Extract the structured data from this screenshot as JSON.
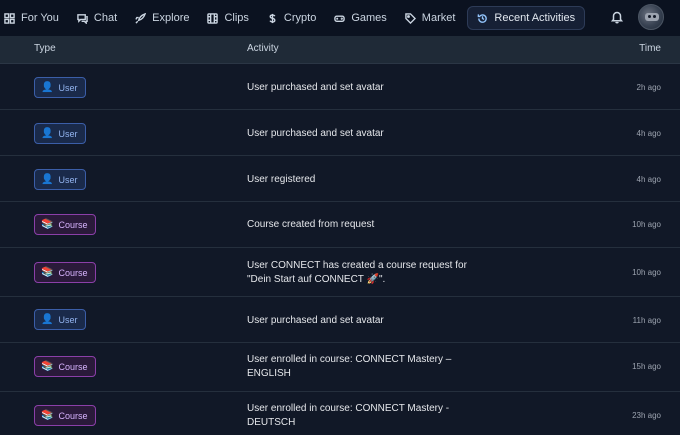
{
  "nav": {
    "items": [
      {
        "label": "For You",
        "icon": "grid-icon"
      },
      {
        "label": "Chat",
        "icon": "chat-icon"
      },
      {
        "label": "Explore",
        "icon": "rocket-icon"
      },
      {
        "label": "Clips",
        "icon": "film-icon"
      },
      {
        "label": "Crypto",
        "icon": "dollar-icon"
      },
      {
        "label": "Games",
        "icon": "gamepad-icon"
      },
      {
        "label": "Market",
        "icon": "tag-icon"
      },
      {
        "label": "Recent Activities",
        "icon": "history-icon",
        "active": true
      }
    ]
  },
  "table": {
    "headers": {
      "type": "Type",
      "activity": "Activity",
      "time": "Time"
    },
    "rows": [
      {
        "type": "User",
        "activity": "User purchased and set avatar",
        "time": "2h ago"
      },
      {
        "type": "User",
        "activity": "User purchased and set avatar",
        "time": "4h ago"
      },
      {
        "type": "User",
        "activity": "User registered",
        "time": "4h ago"
      },
      {
        "type": "Course",
        "activity": "Course created from request",
        "time": "10h ago"
      },
      {
        "type": "Course",
        "activity": "User CONNECT has created a course request for \"Dein Start auf CONNECT 🚀\".",
        "time": "10h ago"
      },
      {
        "type": "User",
        "activity": "User purchased and set avatar",
        "time": "11h ago"
      },
      {
        "type": "Course",
        "activity": "User enrolled in course: CONNECT Mastery – ENGLISH",
        "time": "15h ago"
      },
      {
        "type": "Course",
        "activity": "User enrolled in course: CONNECT Mastery - DEUTSCH",
        "time": "23h ago"
      }
    ]
  },
  "colors": {
    "user_badge": "#3b5ea8",
    "course_badge": "#8b3fa8",
    "background": "#111827"
  }
}
